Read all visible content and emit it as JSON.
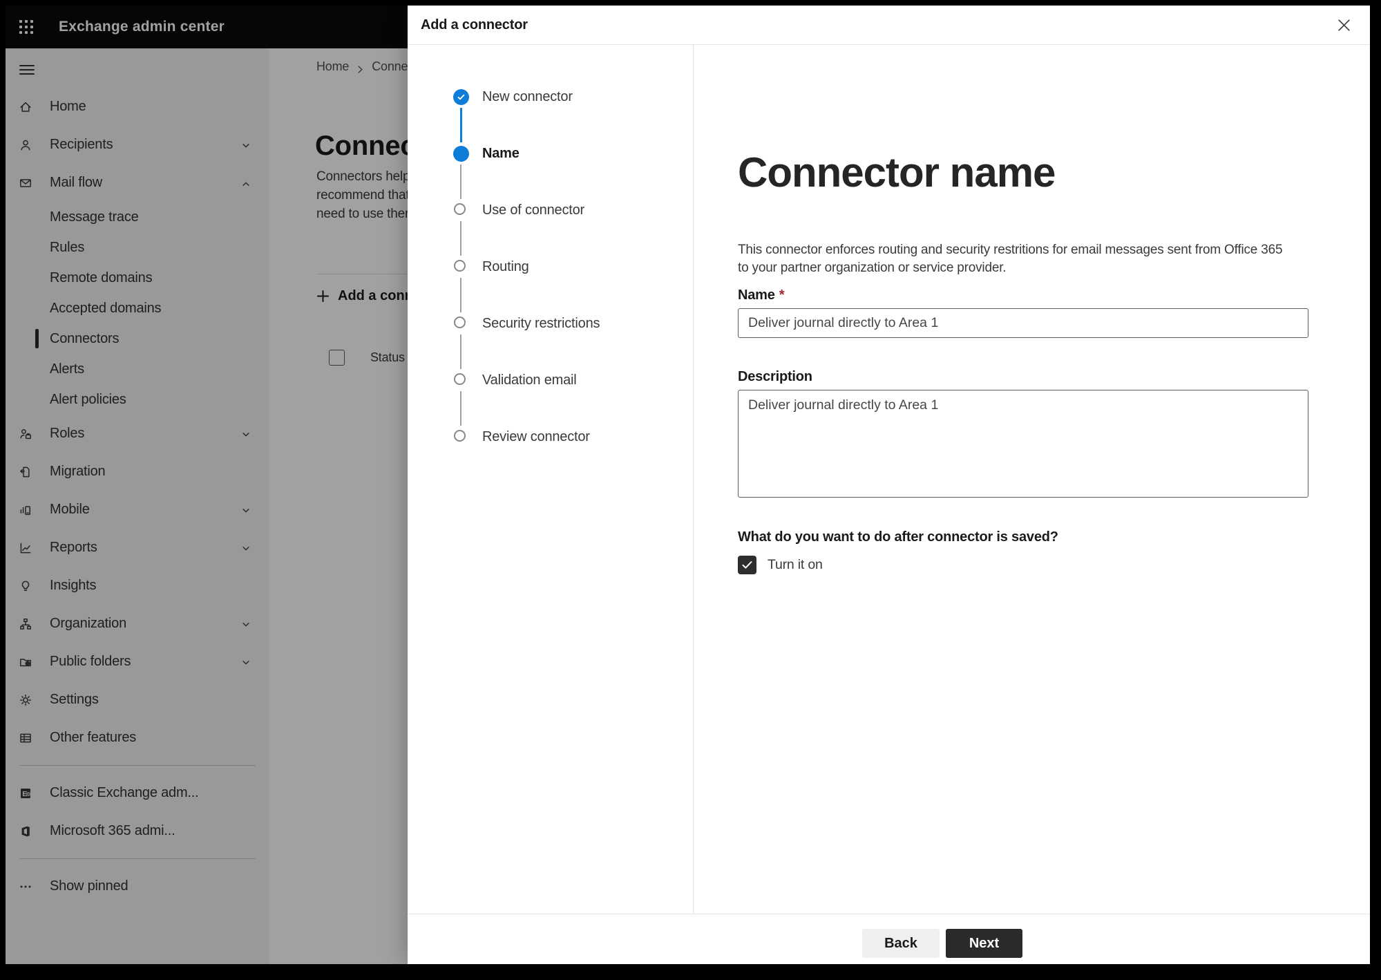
{
  "topbar": {
    "title": "Exchange admin center"
  },
  "sidebar": {
    "items": [
      {
        "label": "Home",
        "icon": "home"
      },
      {
        "label": "Recipients",
        "icon": "person",
        "chevron": "down"
      },
      {
        "label": "Mail flow",
        "icon": "mail",
        "chevron": "up"
      },
      {
        "label": "Message trace",
        "sub": true
      },
      {
        "label": "Rules",
        "sub": true
      },
      {
        "label": "Remote domains",
        "sub": true
      },
      {
        "label": "Accepted domains",
        "sub": true
      },
      {
        "label": "Connectors",
        "sub": true,
        "selected": true
      },
      {
        "label": "Alerts",
        "sub": true
      },
      {
        "label": "Alert policies",
        "sub": true
      },
      {
        "label": "Roles",
        "icon": "roles",
        "chevron": "down"
      },
      {
        "label": "Migration",
        "icon": "migration"
      },
      {
        "label": "Mobile",
        "icon": "mobile",
        "chevron": "down"
      },
      {
        "label": "Reports",
        "icon": "reports",
        "chevron": "down"
      },
      {
        "label": "Insights",
        "icon": "insights"
      },
      {
        "label": "Organization",
        "icon": "organization",
        "chevron": "down"
      },
      {
        "label": "Public folders",
        "icon": "public-folders",
        "chevron": "down"
      },
      {
        "label": "Settings",
        "icon": "settings"
      },
      {
        "label": "Other features",
        "icon": "other-features"
      },
      {
        "divider": true
      },
      {
        "label": "Classic Exchange adm...",
        "icon": "classic-exchange"
      },
      {
        "label": "Microsoft 365 admi...",
        "icon": "microsoft-365"
      },
      {
        "divider": true
      },
      {
        "label": "Show pinned",
        "icon": "show-pinned"
      }
    ]
  },
  "page": {
    "breadcrumb": {
      "home": "Home",
      "current": "Conne"
    },
    "title": "Connec",
    "intro_lines": [
      "Connectors help",
      "recommend that",
      "need to use ther"
    ],
    "add_button_label": "Add a conn",
    "status_column": "Status"
  },
  "dialog": {
    "title": "Add a connector",
    "steps": [
      {
        "label": "New connector",
        "state": "done"
      },
      {
        "label": "Name",
        "state": "current"
      },
      {
        "label": "Use of connector",
        "state": "todo"
      },
      {
        "label": "Routing",
        "state": "todo"
      },
      {
        "label": "Security restrictions",
        "state": "todo"
      },
      {
        "label": "Validation email",
        "state": "todo"
      },
      {
        "label": "Review connector",
        "state": "todo"
      }
    ],
    "heading": "Connector name",
    "description_lines": [
      "This connector enforces routing and security restritions for email messages sent from Office 365",
      "to your partner organization or service provider."
    ],
    "name_label": "Name",
    "required_mark": "*",
    "name_value": "Deliver journal directly to Area 1",
    "description_label": "Description",
    "description_value": "Deliver journal directly to Area 1",
    "after_save_question": "What do you want to do after connector is saved?",
    "turn_on_label": "Turn it on",
    "turn_on_checked": true,
    "back_label": "Back",
    "next_label": "Next"
  },
  "colors": {
    "accent": "#0d7dd9",
    "danger": "#a4262c",
    "primary_button": "#2b2a28"
  }
}
